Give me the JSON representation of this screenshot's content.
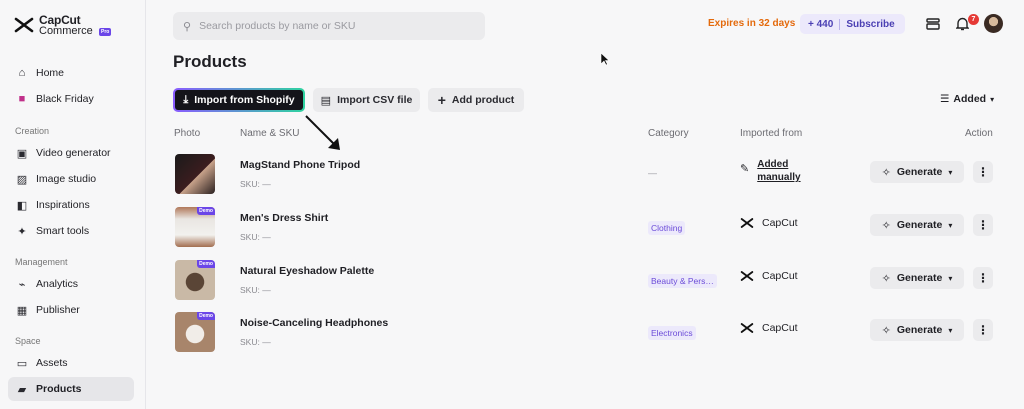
{
  "brand": {
    "line1": "CapCut",
    "line2": "Commerce",
    "badge": "Pro"
  },
  "sidebar": {
    "items_top": [
      {
        "label": "Home",
        "icon": "home-icon"
      },
      {
        "label": "Black Friday",
        "icon": "gift-icon"
      }
    ],
    "section_creation": "Creation",
    "items_creation": [
      {
        "label": "Video generator",
        "icon": "video-icon"
      },
      {
        "label": "Image studio",
        "icon": "image-icon"
      },
      {
        "label": "Inspirations",
        "icon": "inspiration-icon"
      },
      {
        "label": "Smart tools",
        "icon": "magic-icon"
      }
    ],
    "section_management": "Management",
    "items_management": [
      {
        "label": "Analytics",
        "icon": "analytics-icon"
      },
      {
        "label": "Publisher",
        "icon": "calendar-icon"
      }
    ],
    "section_space": "Space",
    "items_space": [
      {
        "label": "Assets",
        "icon": "folder-icon"
      },
      {
        "label": "Products",
        "icon": "bag-icon"
      }
    ]
  },
  "topbar": {
    "search_placeholder": "Search products by name or SKU",
    "expires": "Expires in 32 days",
    "credits": "+ 440",
    "subscribe": "Subscribe",
    "notification_count": "7"
  },
  "main": {
    "title": "Products",
    "btn_shopify": "Import from Shopify",
    "btn_csv": "Import CSV file",
    "btn_add": "Add product",
    "sort_label": "Added",
    "columns": {
      "photo": "Photo",
      "name": "Name & SKU",
      "category": "Category",
      "imported": "Imported from",
      "action": "Action"
    },
    "rows": [
      {
        "name": "MagStand Phone Tripod",
        "sku": "SKU: —",
        "category": "—",
        "imported": "Added manually",
        "demo": false
      },
      {
        "name": "Men's Dress Shirt",
        "sku": "SKU: —",
        "category": "Clothing",
        "imported": "CapCut",
        "demo": true
      },
      {
        "name": "Natural Eyeshadow Palette",
        "sku": "SKU: —",
        "category": "Beauty & Pers…",
        "imported": "CapCut",
        "demo": true
      },
      {
        "name": "Noise-Canceling Headphones",
        "sku": "SKU: —",
        "category": "Electronics",
        "imported": "CapCut",
        "demo": true
      }
    ],
    "generate_label": "Generate",
    "demo_label": "Demo"
  },
  "colors": {
    "accent": "#6b46e8",
    "expires": "#e46a0c",
    "badge_red": "#e53935"
  }
}
